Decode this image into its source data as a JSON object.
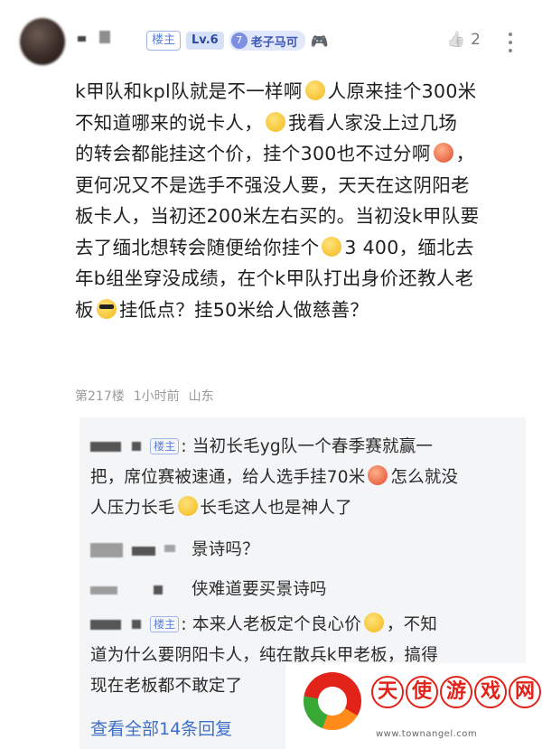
{
  "header": {
    "badge_owner": "楼主",
    "badge_level": "Lv.6",
    "fan_level": "7",
    "fan_name": "老子马可",
    "gamepad_icon": "🎮",
    "like_count": "2",
    "like_icon": "👍"
  },
  "post": {
    "lines": [
      "k甲队和kpl队就是不一样啊",
      "人原来挂个300米",
      "不知道哪来的说卡人，",
      "我看人家没上过几场",
      "的转会都能挂这个价，挂个300也不过分啊",
      "，",
      "更何况又不是选手不强没人要，天天在这阴阳老",
      "板卡人，当初还200米左右买的。当初没k甲队要",
      "去了缅北想转会随便给你挂个",
      "3 400，缅北去",
      "年b组坐穿没成绩，在个k甲队打出身价还教人老",
      "板",
      "挂低点？挂50米给人做慈善？"
    ]
  },
  "meta": {
    "floor": "第217楼",
    "time": "1小时前",
    "location": "山东"
  },
  "replies": {
    "items": [
      {
        "badge": "楼主",
        "line1": ": 当初长毛yg队一个春季赛就赢一",
        "line2a": "把，席位赛被速通，给人选手挂70米",
        "line2b": "怎么就没",
        "line3a": "人压力长毛",
        "line3b": "长毛这人也是神人了"
      },
      {
        "text": "景诗吗？"
      },
      {
        "text": "侠难道要买景诗吗"
      },
      {
        "badge": "楼主",
        "line1a": ": 本来人老板定个良心价",
        "line1b": "，不知",
        "line2": "道为什么要阴阳卡人，纯在散兵k甲老板，搞得",
        "line3": "现在老板都不敢定了"
      }
    ],
    "view_all": "查看全部14条回复"
  },
  "watermark": {
    "chars": [
      "天",
      "使",
      "游",
      "戏",
      "网"
    ],
    "url": "www.townangel.com"
  }
}
